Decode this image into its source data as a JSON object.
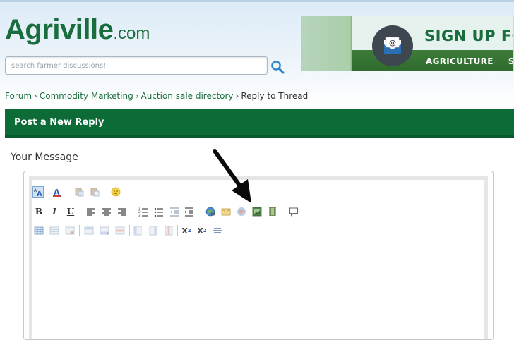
{
  "logo": {
    "name": "Agriville",
    "tld": ".com"
  },
  "search": {
    "placeholder": "search farmer discussions!"
  },
  "banner": {
    "title": "SIGN UP FOR",
    "tab1": "AGRICULTURE",
    "tab2": "SW"
  },
  "breadcrumb": {
    "items": [
      "Forum",
      "Commodity Marketing",
      "Auction sale directory"
    ],
    "separator": "›",
    "current": "Reply to Thread"
  },
  "reply_bar": {
    "title": "Post a New Reply"
  },
  "message": {
    "label": "Your Message"
  },
  "colors": {
    "brand_green": "#1a6e3d",
    "bar_green": "#0d6b38",
    "link_green": "#1a6e3d"
  },
  "toolbar": {
    "bold": "B",
    "italic": "I",
    "underline": "U",
    "subscript": "X",
    "sub_mark": "2",
    "superscript": "X",
    "sup_mark": "2",
    "font_mark": "A"
  }
}
